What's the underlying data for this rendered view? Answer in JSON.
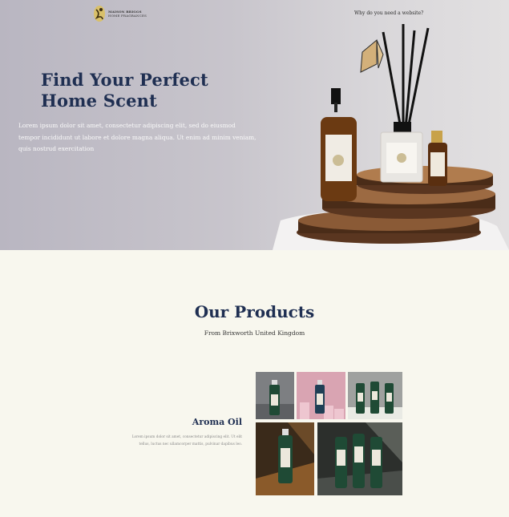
{
  "header": {
    "logo_line1": "MAISON BRIGGS",
    "logo_line2": "HOME FRAGRANCES",
    "nav_link": "Why do you need a website?"
  },
  "hero": {
    "title_line1": "Find Your Perfect",
    "title_line2": "Home Scent",
    "body": "Lorem ipsum dolor sit amet, consectetur adipiscing elit, sed do eiusmod tempor incididunt ut labore et dolore magna aliqua. Ut enim ad minim veniam, quis nostrud exercitation"
  },
  "products": {
    "title": "Our Products",
    "subtitle": "From Brixworth United Kingdom",
    "featured": {
      "name": "Aroma Oil",
      "description": "Lorem ipsum dolor sit amet, consectetur adipiscing elit. Ut elit tellus, luctus nec ullamcorper mattis, pulvinar dapibus leo."
    }
  },
  "colors": {
    "navy": "#1f2f52",
    "cream": "#f8f7ee",
    "bottle_green": "#1f4a35",
    "amber": "#6b3a12"
  }
}
